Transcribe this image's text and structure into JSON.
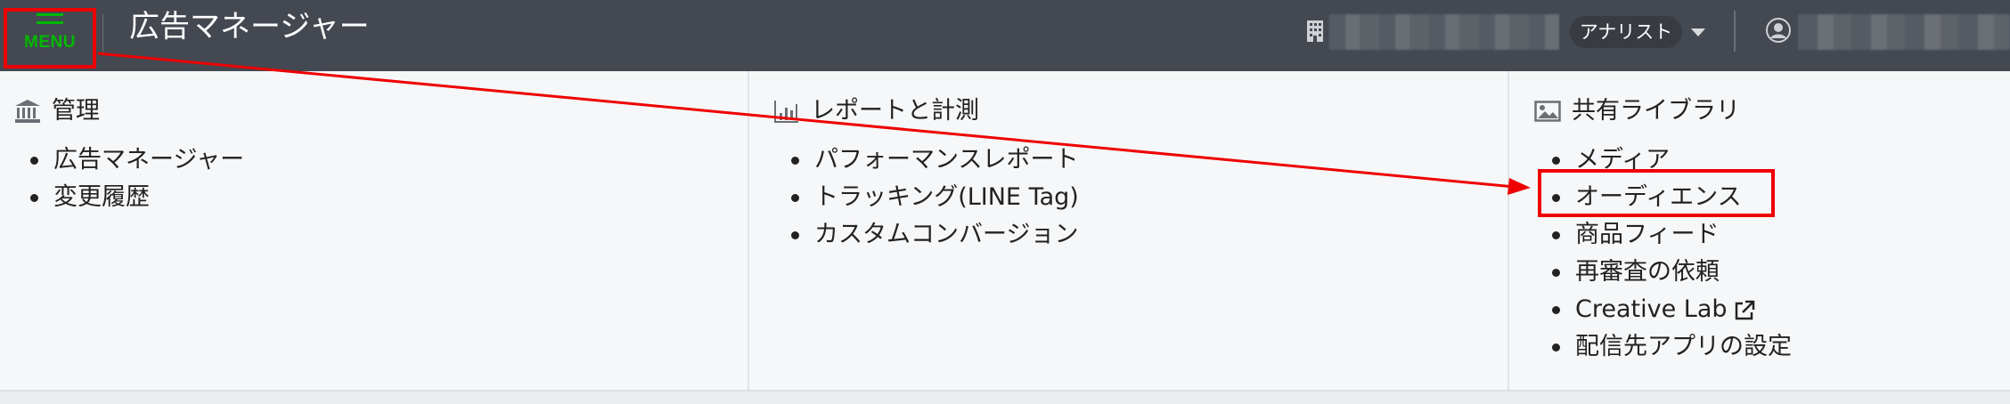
{
  "header": {
    "menu_label": "MENU",
    "app_title": "広告マネージャー",
    "role": "アナリスト"
  },
  "sections": {
    "management": {
      "title": "管理",
      "items": [
        "広告マネージャー",
        "変更履歴"
      ]
    },
    "reports": {
      "title": "レポートと計測",
      "items": [
        "パフォーマンスレポート",
        "トラッキング(LINE Tag)",
        "カスタムコンバージョン"
      ]
    },
    "library": {
      "title": "共有ライブラリ",
      "items": [
        "メディア",
        "オーディエンス",
        "商品フィード",
        "再審査の依頼",
        "Creative Lab",
        "配信先アプリの設定"
      ]
    }
  },
  "colors": {
    "header_bg": "#444851",
    "brand_green": "#00b900",
    "annotation_red": "#ee0000",
    "panel_bg": "#f6f7f8"
  },
  "icons": {
    "menu": "hamburger-icon",
    "account": "building-icon",
    "role_dropdown": "caret-down-icon",
    "user": "user-avatar-icon",
    "management": "bank-icon",
    "reports": "bar-chart-icon",
    "library": "image-icon",
    "creative_lab": "external-link-icon"
  }
}
